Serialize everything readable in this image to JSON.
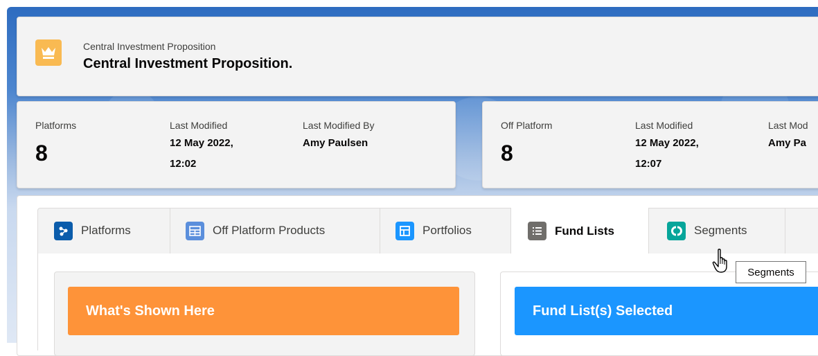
{
  "header": {
    "subtitle": "Central Investment Proposition",
    "title": "Central Investment Proposition.",
    "icon": "crown-icon",
    "icon_color": "#f9ba52"
  },
  "stats_platforms": {
    "count_label": "Platforms",
    "count": "8",
    "modified_label": "Last Modified",
    "modified_line1": "12 May 2022,",
    "modified_line2": "12:02",
    "modified_by_label": "Last Modified By",
    "modified_by": "Amy Paulsen"
  },
  "stats_off_platform": {
    "count_label": "Off Platform",
    "count": "8",
    "modified_label": "Last Modified",
    "modified_line1": "12 May 2022,",
    "modified_line2": "12:07",
    "modified_by_label": "Last Mod",
    "modified_by": "Amy Pa"
  },
  "tabs": [
    {
      "label": "Platforms",
      "icon": "platforms-icon",
      "color": "#0b5cab",
      "active": false
    },
    {
      "label": "Off Platform Products",
      "icon": "table-icon",
      "color": "#5b8fdc",
      "active": false
    },
    {
      "label": "Portfolios",
      "icon": "portfolio-icon",
      "color": "#1b96ff",
      "active": false
    },
    {
      "label": "Fund Lists",
      "icon": "list-icon",
      "color": "#706e6b",
      "active": true
    },
    {
      "label": "Segments",
      "icon": "segments-icon",
      "color": "#06a59a",
      "active": false
    }
  ],
  "tooltip": "Segments",
  "panels": {
    "left_banner": "What's Shown Here",
    "left_color": "#fe9339",
    "right_banner": "Fund List(s) Selected",
    "right_color": "#1b96ff"
  }
}
